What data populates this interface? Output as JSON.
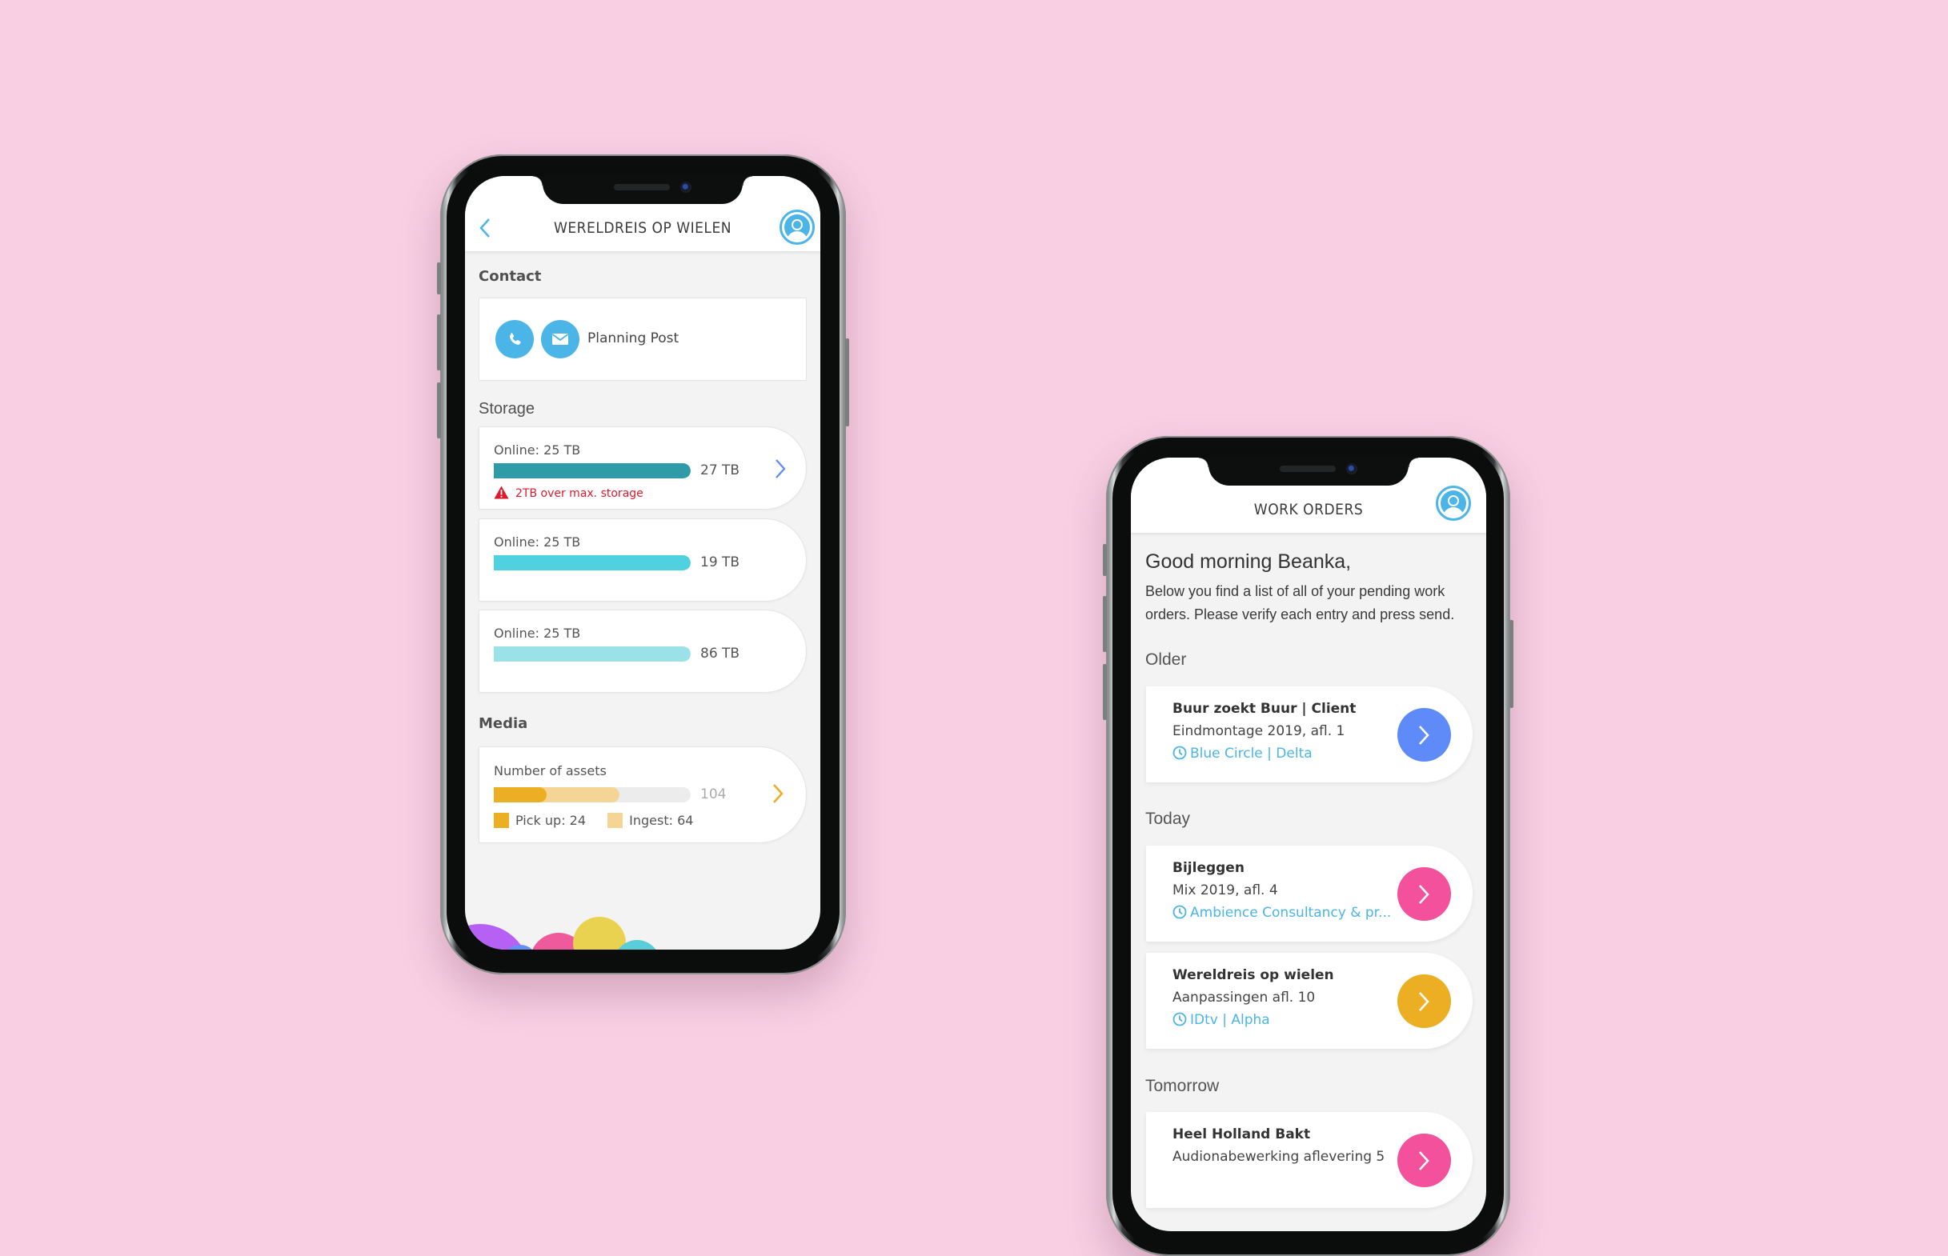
{
  "colors": {
    "background": "#f8cfe3",
    "accent_blue": "#4ab5e6",
    "warning_red": "#e0182d",
    "storage_bar_1": "#2f9aa8",
    "storage_bar_2": "#4fd1e0",
    "storage_bar_3": "#9ae1e8",
    "pickup": "#ecae22",
    "ingest": "#f4d595",
    "track": "#ececec",
    "btn_blue": "#5f8bf9",
    "btn_pink": "#f3519c",
    "btn_yellow": "#ecae22"
  },
  "phone1": {
    "header": {
      "title": "WERELDREIS OP WIELEN",
      "back_icon": "chevron-left-icon",
      "avatar_icon": "user-avatar-icon"
    },
    "contact": {
      "label": "Contact",
      "name": "Planning Post",
      "icons": [
        "phone-icon",
        "mail-icon"
      ]
    },
    "storage": {
      "label": "Storage",
      "items": [
        {
          "label": "Online: 25 TB",
          "value": "27 TB",
          "fill": 1.0,
          "color": "#2f9aa8",
          "warning": "2TB over max. storage",
          "has_chevron": true
        },
        {
          "label": "Online: 25 TB",
          "value": "19 TB",
          "fill": 1.0,
          "color": "#4fd1e0",
          "warning": null,
          "has_chevron": false
        },
        {
          "label": "Online: 25 TB",
          "value": "86 TB",
          "fill": 1.0,
          "color": "#9ae1e8",
          "warning": null,
          "has_chevron": false
        }
      ]
    },
    "media": {
      "label": "Media",
      "title": "Number of assets",
      "total": "104",
      "pickup_fraction": 0.27,
      "ingest_fraction": 0.64,
      "legend": [
        {
          "label": "Pick up: 24",
          "color": "#ecae22"
        },
        {
          "label": "Ingest: 64",
          "color": "#f4d595"
        }
      ]
    }
  },
  "phone2": {
    "header": {
      "title": "WORK ORDERS",
      "avatar_icon": "user-avatar-icon"
    },
    "greeting": "Good morning Beanka,",
    "intro": "Below you find a list of all of your pending work orders. Please verify each entry and press send.",
    "groups": [
      {
        "label": "Older",
        "orders": [
          {
            "title": "Buur zoekt Buur | Client",
            "subtitle": "Eindmontage 2019, afl. 1",
            "meta": "Blue Circle | Delta",
            "color": "#5f8bf9"
          }
        ]
      },
      {
        "label": "Today",
        "orders": [
          {
            "title": "Bijleggen",
            "subtitle": "Mix 2019, afl. 4",
            "meta": "Ambience Consultancy & pr...",
            "color": "#f3519c"
          },
          {
            "title": "Wereldreis op wielen",
            "subtitle": "Aanpassingen afl. 10",
            "meta": "IDtv | Alpha",
            "color": "#ecae22"
          }
        ]
      },
      {
        "label": "Tomorrow",
        "orders": [
          {
            "title": "Heel Holland Bakt",
            "subtitle": "Audionabewerking aflevering 5",
            "meta": "",
            "color": "#f3519c"
          }
        ]
      }
    ]
  }
}
